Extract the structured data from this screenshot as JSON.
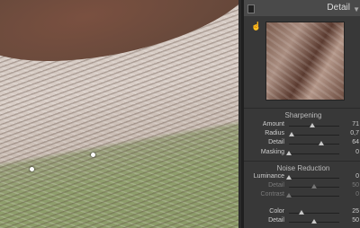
{
  "panel": {
    "title": "Detail",
    "hand_icon": "targeted-adjustment-hand-icon",
    "collapse_icon": "triangle-down-icon"
  },
  "sharpening": {
    "heading": "Sharpening",
    "rows": [
      {
        "label": "Amount",
        "value": "71",
        "level": 0.47
      },
      {
        "label": "Radius",
        "value": "0,7",
        "level": 0.05
      },
      {
        "label": "Detail",
        "value": "64",
        "level": 0.64
      },
      {
        "label": "Masking",
        "value": "0",
        "level": 0.0
      }
    ]
  },
  "noise_reduction": {
    "heading": "Noise Reduction",
    "rows": [
      {
        "label": "Luminance",
        "value": "0",
        "level": 0.0,
        "dim": false
      },
      {
        "label": "Detail",
        "value": "50",
        "level": 0.5,
        "dim": true
      },
      {
        "label": "Contrast",
        "value": "0",
        "level": 0.0,
        "dim": true
      },
      {
        "label": "Color",
        "value": "25",
        "level": 0.25,
        "dim": false
      },
      {
        "label": "Detail",
        "value": "50",
        "level": 0.5,
        "dim": false
      }
    ]
  }
}
